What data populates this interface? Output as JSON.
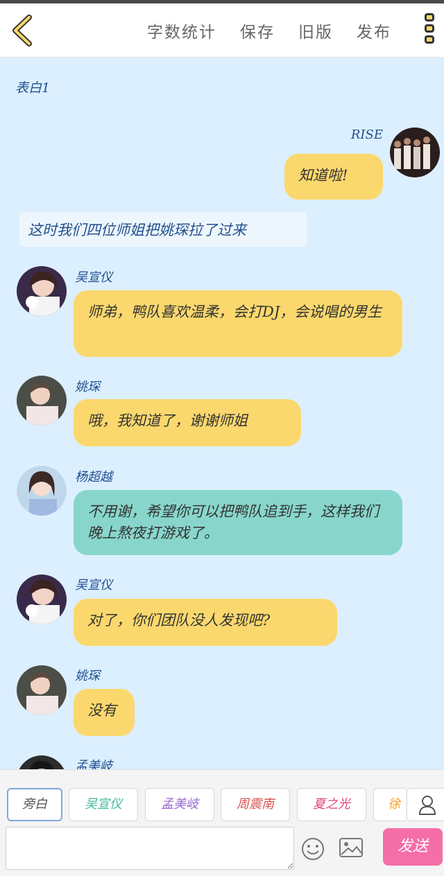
{
  "header": {
    "word_count": "字数统计",
    "save": "保存",
    "old_version": "旧版",
    "publish": "发布"
  },
  "chat": {
    "title_note": "表白1",
    "narration": "这时我们四位师姐把姚琛拉了过来",
    "messages": [
      {
        "name": "RISE",
        "text": "知道啦!"
      },
      {
        "name": "吴宣仪",
        "text": "师弟，鸭队喜欢温柔，会打DJ，会说唱的男生"
      },
      {
        "name": "姚琛",
        "text": "哦，我知道了，谢谢师姐"
      },
      {
        "name": "杨超越",
        "text": "不用谢，希望你可以把鸭队追到手，这样我们晚上熬夜打游戏了。"
      },
      {
        "name": "吴宣仪",
        "text": "对了，你们团队没人发现吧?"
      },
      {
        "name": "姚琛",
        "text": "没有"
      },
      {
        "name": "孟美岐",
        "text": ""
      }
    ]
  },
  "roles": [
    {
      "label": "旁白",
      "color": "#555555"
    },
    {
      "label": "吴宣仪",
      "color": "#3fb89a"
    },
    {
      "label": "孟美岐",
      "color": "#9a6ad0"
    },
    {
      "label": "周震南",
      "color": "#d9534f"
    },
    {
      "label": "夏之光",
      "color": "#e0457d"
    },
    {
      "label": "徐",
      "color": "#f0a020"
    }
  ],
  "composer": {
    "input_value": "",
    "send_label": "发送"
  },
  "colors": {
    "background": "#dcefff",
    "bubble_yellow": "#fbd86d",
    "bubble_teal": "#88d6cb",
    "send": "#f46ea8"
  }
}
